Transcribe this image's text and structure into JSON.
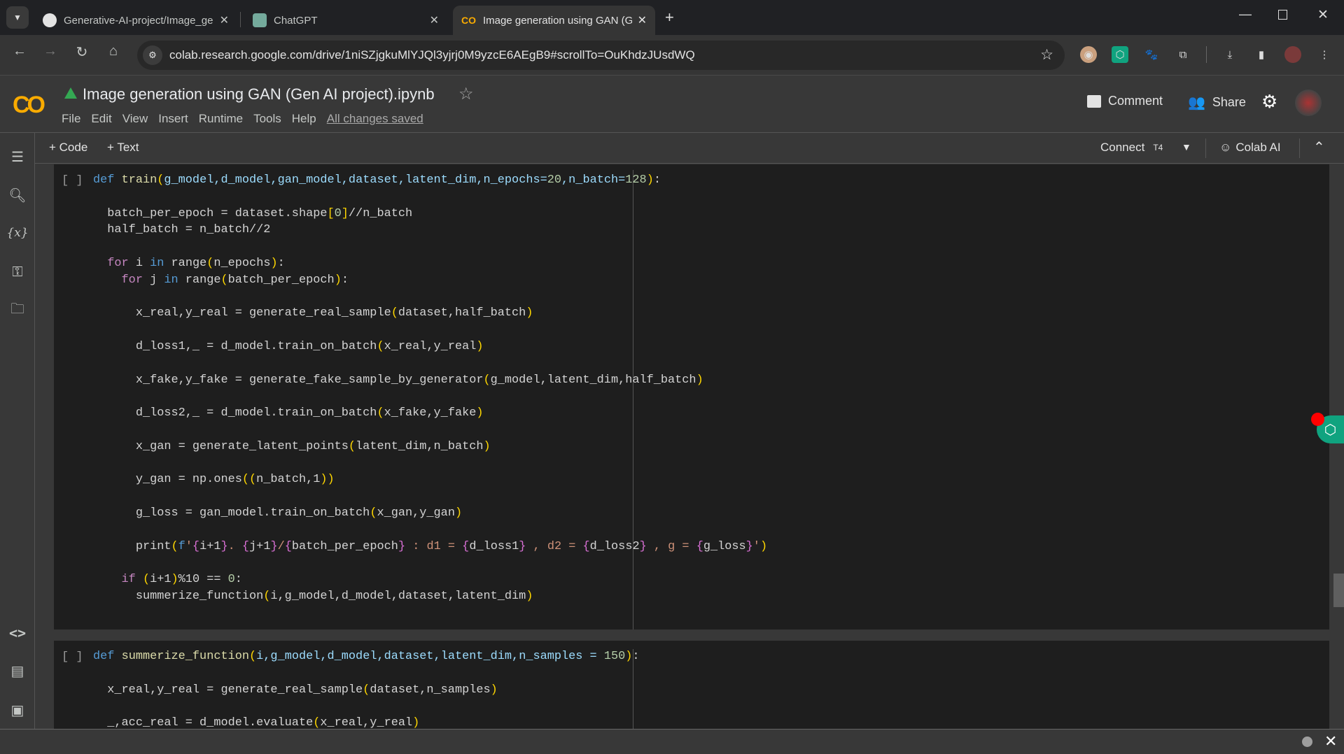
{
  "browser": {
    "tabs": [
      {
        "title": "Generative-AI-project/Image_ge",
        "icon": "github-icon"
      },
      {
        "title": "ChatGPT",
        "icon": "chatgpt-icon"
      },
      {
        "title": "Image generation using GAN (G",
        "icon": "colab-icon",
        "active": true
      }
    ],
    "url": "colab.research.google.com/drive/1niSZjgkuMlYJQl3yjrj0M9yzcE6AEgB9#scrollTo=OuKhdzJUsdWQ"
  },
  "notebook": {
    "title": "Image generation using GAN (Gen AI project).ipynb",
    "menu": [
      "File",
      "Edit",
      "View",
      "Insert",
      "Runtime",
      "Tools",
      "Help"
    ],
    "save_status": "All changes saved",
    "comment_label": "Comment",
    "share_label": "Share"
  },
  "toolbar": {
    "add_code": "+ Code",
    "add_text": "+ Text",
    "connect": "Connect",
    "runtime_type": "T4",
    "colab_ai": "Colab AI"
  },
  "cells": [
    {
      "run_label": "[ ]",
      "lines": [
        [
          [
            "def",
            "k"
          ],
          [
            " ",
            "t"
          ],
          [
            "train",
            "fn"
          ],
          [
            "(",
            "p"
          ],
          [
            "g_model,d_model,gan_model,dataset,latent_dim,n_epochs=",
            "pa"
          ],
          [
            "20",
            "n"
          ],
          [
            ",n_batch=",
            "pa"
          ],
          [
            "128",
            "n"
          ],
          [
            ")",
            "p"
          ],
          [
            ":",
            "t"
          ]
        ],
        [],
        [
          [
            "  batch_per_epoch = dataset.shape",
            "t"
          ],
          [
            "[",
            "p"
          ],
          [
            "0",
            "n"
          ],
          [
            "]",
            "p"
          ],
          [
            "//n_batch",
            "t"
          ]
        ],
        [
          [
            "  half_batch = n_batch//2",
            "t"
          ]
        ],
        [],
        [
          [
            "  ",
            "t"
          ],
          [
            "for",
            "c"
          ],
          [
            " i ",
            "t"
          ],
          [
            "in",
            "k"
          ],
          [
            " range",
            "t"
          ],
          [
            "(",
            "p"
          ],
          [
            "n_epochs",
            "t"
          ],
          [
            ")",
            "p"
          ],
          [
            ":",
            "t"
          ]
        ],
        [
          [
            "    ",
            "t"
          ],
          [
            "for",
            "c"
          ],
          [
            " j ",
            "t"
          ],
          [
            "in",
            "k"
          ],
          [
            " range",
            "t"
          ],
          [
            "(",
            "p"
          ],
          [
            "batch_per_epoch",
            "t"
          ],
          [
            ")",
            "p"
          ],
          [
            ":",
            "t"
          ]
        ],
        [],
        [
          [
            "      x_real,y_real = generate_real_sample",
            "t"
          ],
          [
            "(",
            "p"
          ],
          [
            "dataset,half_batch",
            "t"
          ],
          [
            ")",
            "p"
          ]
        ],
        [],
        [
          [
            "      d_loss1,_ = d_model.train_on_batch",
            "t"
          ],
          [
            "(",
            "p"
          ],
          [
            "x_real,y_real",
            "t"
          ],
          [
            ")",
            "p"
          ]
        ],
        [],
        [
          [
            "      x_fake,y_fake = generate_fake_sample_by_generator",
            "t"
          ],
          [
            "(",
            "p"
          ],
          [
            "g_model,latent_dim,half_batch",
            "t"
          ],
          [
            ")",
            "p"
          ]
        ],
        [],
        [
          [
            "      d_loss2,_ = d_model.train_on_batch",
            "t"
          ],
          [
            "(",
            "p"
          ],
          [
            "x_fake,y_fake",
            "t"
          ],
          [
            ")",
            "p"
          ]
        ],
        [],
        [
          [
            "      x_gan = generate_latent_points",
            "t"
          ],
          [
            "(",
            "p"
          ],
          [
            "latent_dim,n_batch",
            "t"
          ],
          [
            ")",
            "p"
          ]
        ],
        [],
        [
          [
            "      y_gan = np.ones",
            "t"
          ],
          [
            "((",
            "p"
          ],
          [
            "n_batch,1",
            "t"
          ],
          [
            "))",
            "p"
          ]
        ],
        [],
        [
          [
            "      g_loss = gan_model.train_on_batch",
            "t"
          ],
          [
            "(",
            "p"
          ],
          [
            "x_gan,y_gan",
            "t"
          ],
          [
            ")",
            "p"
          ]
        ],
        [],
        [
          [
            "      print",
            "t"
          ],
          [
            "(",
            "p"
          ],
          [
            "f",
            "k"
          ],
          [
            "'",
            "s"
          ],
          [
            "{",
            "b"
          ],
          [
            "i+1",
            "t"
          ],
          [
            "}",
            "b"
          ],
          [
            ". ",
            "s"
          ],
          [
            "{",
            "b"
          ],
          [
            "j+1",
            "t"
          ],
          [
            "}",
            "b"
          ],
          [
            "/",
            "s"
          ],
          [
            "{",
            "b"
          ],
          [
            "batch_per_epoch",
            "t"
          ],
          [
            "}",
            "b"
          ],
          [
            " : d1 = ",
            "s"
          ],
          [
            "{",
            "b"
          ],
          [
            "d_loss1",
            "t"
          ],
          [
            "}",
            "b"
          ],
          [
            " , d2 = ",
            "s"
          ],
          [
            "{",
            "b"
          ],
          [
            "d_loss2",
            "t"
          ],
          [
            "}",
            "b"
          ],
          [
            " , g = ",
            "s"
          ],
          [
            "{",
            "b"
          ],
          [
            "g_loss",
            "t"
          ],
          [
            "}",
            "b"
          ],
          [
            "'",
            "s"
          ],
          [
            ")",
            "p"
          ]
        ],
        [],
        [
          [
            "    ",
            "t"
          ],
          [
            "if",
            "c"
          ],
          [
            " ",
            "t"
          ],
          [
            "(",
            "p"
          ],
          [
            "i+1",
            "t"
          ],
          [
            ")",
            "p"
          ],
          [
            "%10 == ",
            "t"
          ],
          [
            "0",
            "n"
          ],
          [
            ":",
            "t"
          ]
        ],
        [
          [
            "      summerize_function",
            "t"
          ],
          [
            "(",
            "p"
          ],
          [
            "i,g_model,d_model,dataset,latent_dim",
            "t"
          ],
          [
            ")",
            "p"
          ]
        ]
      ]
    },
    {
      "run_label": "[ ]",
      "lines": [
        [
          [
            "def",
            "k"
          ],
          [
            " ",
            "t"
          ],
          [
            "summerize_function",
            "fn"
          ],
          [
            "(",
            "p"
          ],
          [
            "i,g_model,d_model,dataset,latent_dim,n_samples = ",
            "pa"
          ],
          [
            "150",
            "n"
          ],
          [
            ")",
            "p"
          ],
          [
            ":",
            "t"
          ]
        ],
        [],
        [
          [
            "  x_real,y_real = generate_real_sample",
            "t"
          ],
          [
            "(",
            "p"
          ],
          [
            "dataset,n_samples",
            "t"
          ],
          [
            ")",
            "p"
          ]
        ],
        [],
        [
          [
            "  _,acc_real = d_model.evaluate",
            "t"
          ],
          [
            "(",
            "p"
          ],
          [
            "x_real,y_real",
            "t"
          ],
          [
            ")",
            "p"
          ]
        ]
      ]
    }
  ],
  "colors": {
    "colab_orange": "#f9ab00",
    "extension_green": "#10a37f",
    "notification_red": "#ff0000"
  }
}
